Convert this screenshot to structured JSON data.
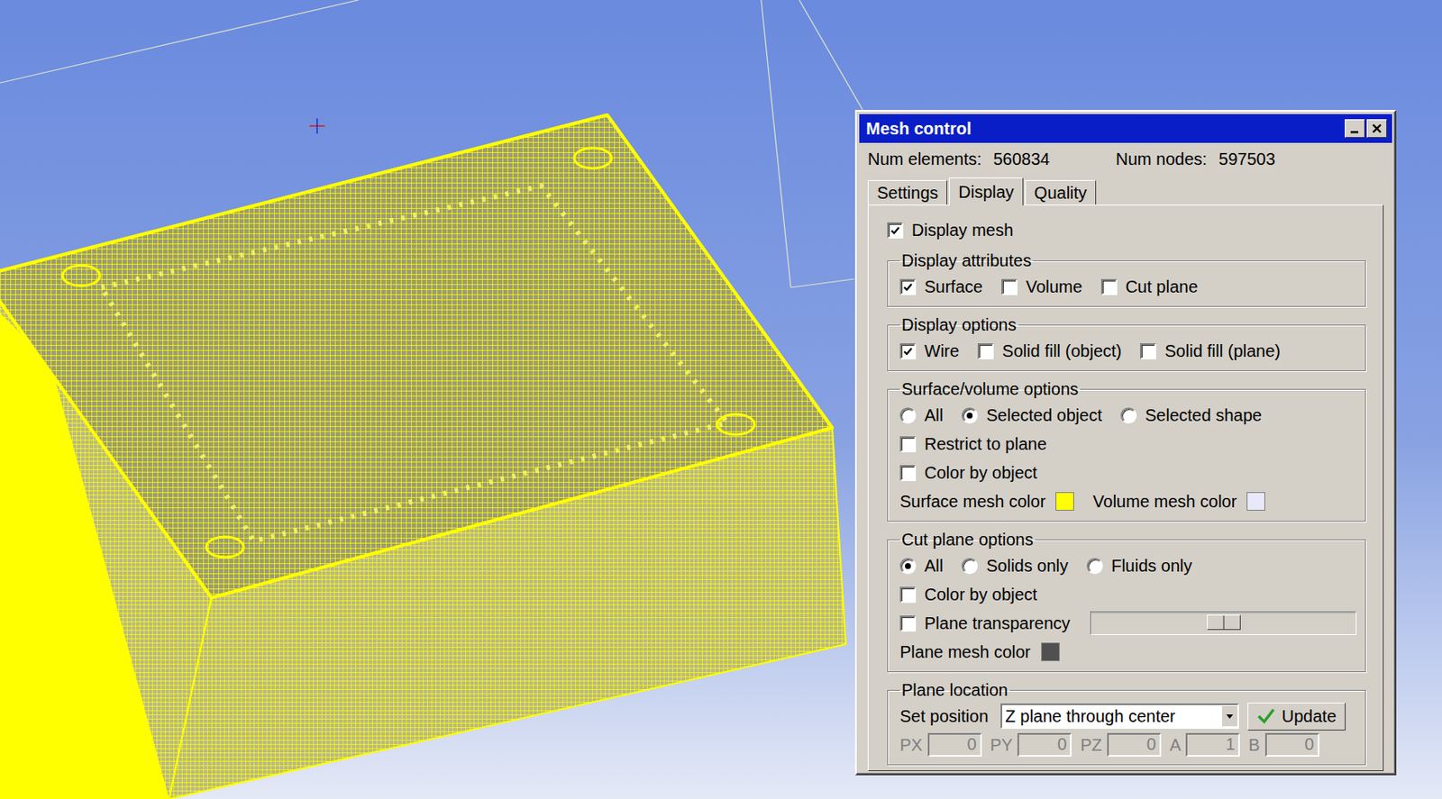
{
  "window": {
    "title": "Mesh control"
  },
  "stats": [
    {
      "label": "Num elements:",
      "value": "560834"
    },
    {
      "label": "Num nodes:",
      "value": "597503"
    }
  ],
  "tabs": [
    {
      "label": "Settings",
      "selected": false
    },
    {
      "label": "Display",
      "selected": true
    },
    {
      "label": "Quality",
      "selected": false
    }
  ],
  "display_mesh": {
    "label": "Display mesh",
    "checked": true
  },
  "display_attributes": {
    "title": "Display attributes",
    "options": [
      {
        "label": "Surface",
        "checked": true
      },
      {
        "label": "Volume",
        "checked": false
      },
      {
        "label": "Cut plane",
        "checked": false
      }
    ]
  },
  "display_options": {
    "title": "Display options",
    "options": [
      {
        "label": "Wire",
        "checked": true
      },
      {
        "label": "Solid fill (object)",
        "checked": false
      },
      {
        "label": "Solid fill (plane)",
        "checked": false
      }
    ]
  },
  "surface_volume_options": {
    "title": "Surface/volume options",
    "radios": [
      {
        "label": "All",
        "selected": false
      },
      {
        "label": "Selected object",
        "selected": true
      },
      {
        "label": "Selected shape",
        "selected": false
      }
    ],
    "checks": [
      {
        "label": "Restrict to plane",
        "checked": false
      },
      {
        "label": "Color by object",
        "checked": false
      }
    ],
    "colors": [
      {
        "label": "Surface mesh color",
        "color": "#ffff00"
      },
      {
        "label": "Volume mesh color",
        "color": "#e8e8f8"
      }
    ]
  },
  "cut_plane_options": {
    "title": "Cut plane options",
    "radios": [
      {
        "label": "All",
        "selected": true
      },
      {
        "label": "Solids only",
        "selected": false
      },
      {
        "label": "Fluids only",
        "selected": false
      }
    ],
    "checks": [
      {
        "label": "Color by object",
        "checked": false
      }
    ],
    "transparency": {
      "label": "Plane transparency",
      "checked": false,
      "level": 0.5
    },
    "colors": [
      {
        "label": "Plane mesh color",
        "color": "#505050"
      }
    ]
  },
  "plane_location": {
    "title": "Plane location",
    "set_position": {
      "label": "Set position",
      "value": "Z plane through center"
    },
    "update_button": "Update",
    "fields": [
      {
        "label": "PX",
        "value": "0",
        "disabled": true
      },
      {
        "label": "PY",
        "value": "0",
        "disabled": true
      },
      {
        "label": "PZ",
        "value": "0",
        "disabled": true
      },
      {
        "label": "A",
        "value": "1",
        "disabled": true
      },
      {
        "label": "B",
        "value": "0",
        "disabled": true
      }
    ]
  }
}
